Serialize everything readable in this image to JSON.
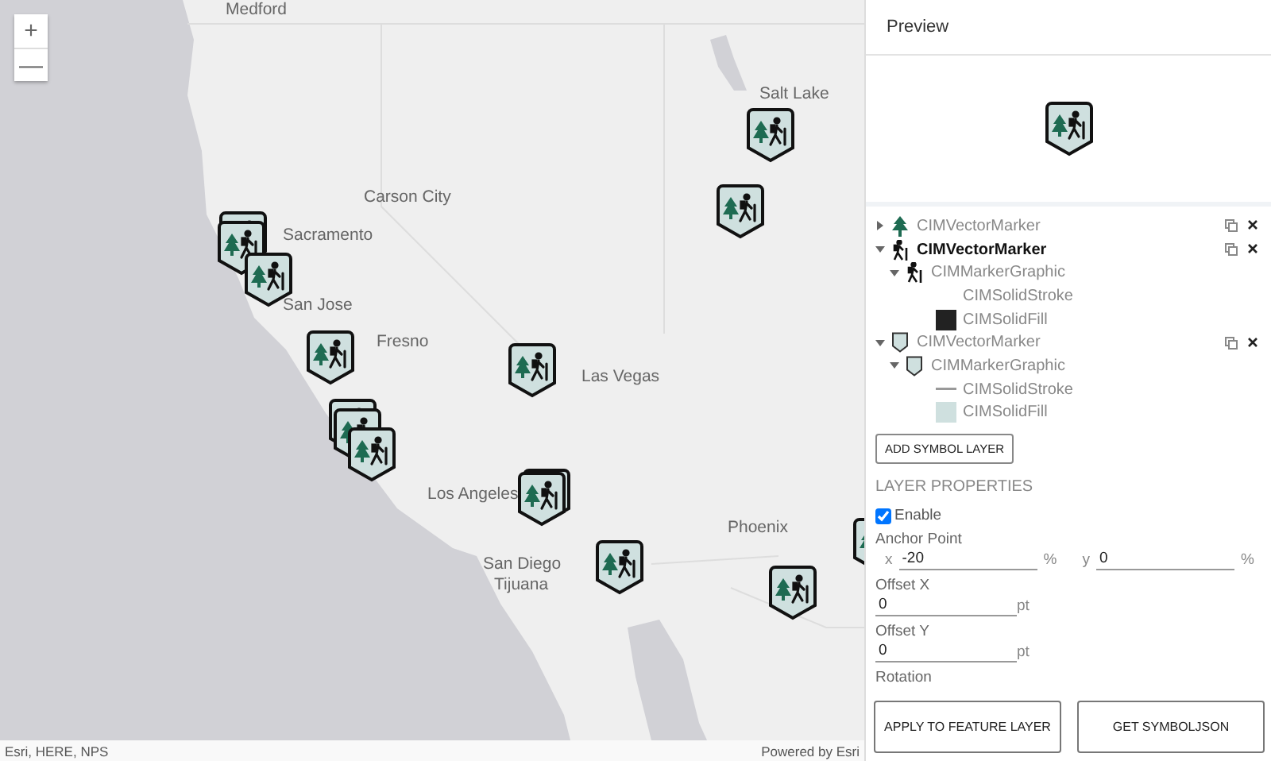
{
  "map": {
    "zoom_in": "+",
    "zoom_out": "—",
    "labels": [
      "Medford",
      "Salt Lake",
      "Carson City",
      "Sacramento",
      "San Jose",
      "Fresno",
      "Las Vegas",
      "Los Angeles",
      "Phoenix",
      "San Diego",
      "Tijuana"
    ],
    "attribution": "Esri, HERE, NPS",
    "powered_by": "Powered by Esri"
  },
  "panel": {
    "title": "Preview",
    "layers": [
      {
        "kind": "vector_marker",
        "label": "CIMVectorMarker",
        "selected": false,
        "expanded": false
      },
      {
        "kind": "vector_marker",
        "label": "CIMVectorMarker",
        "selected": true,
        "expanded": true,
        "children": [
          {
            "kind": "marker_graphic",
            "label": "CIMMarkerGraphic",
            "expanded": true,
            "children": [
              {
                "kind": "solid_stroke",
                "label": "CIMSolidStroke"
              },
              {
                "kind": "solid_fill",
                "label": "CIMSolidFill",
                "color": "#222222"
              }
            ]
          }
        ]
      },
      {
        "kind": "vector_marker",
        "label": "CIMVectorMarker",
        "selected": false,
        "expanded": true,
        "children": [
          {
            "kind": "marker_graphic",
            "label": "CIMMarkerGraphic",
            "expanded": true,
            "children": [
              {
                "kind": "solid_stroke",
                "label": "CIMSolidStroke",
                "color": "#999999"
              },
              {
                "kind": "solid_fill",
                "label": "CIMSolidFill",
                "color": "#cfe0df"
              }
            ]
          }
        ]
      }
    ],
    "add_button": "ADD SYMBOL LAYER",
    "section_title": "LAYER PROPERTIES",
    "enable": {
      "label": "Enable",
      "checked": true
    },
    "anchor": {
      "label": "Anchor Point",
      "x_label": "x",
      "x_value": "-20",
      "x_unit": "%",
      "y_label": "y",
      "y_value": "0",
      "y_unit": "%"
    },
    "offset_x": {
      "label": "Offset X",
      "value": "0",
      "unit": "pt"
    },
    "offset_y": {
      "label": "Offset Y",
      "value": "0",
      "unit": "pt"
    },
    "rotation": {
      "label": "Rotation"
    },
    "buttons": [
      "APPLY TO FEATURE LAYER",
      "GET SYMBOLJSON"
    ]
  }
}
